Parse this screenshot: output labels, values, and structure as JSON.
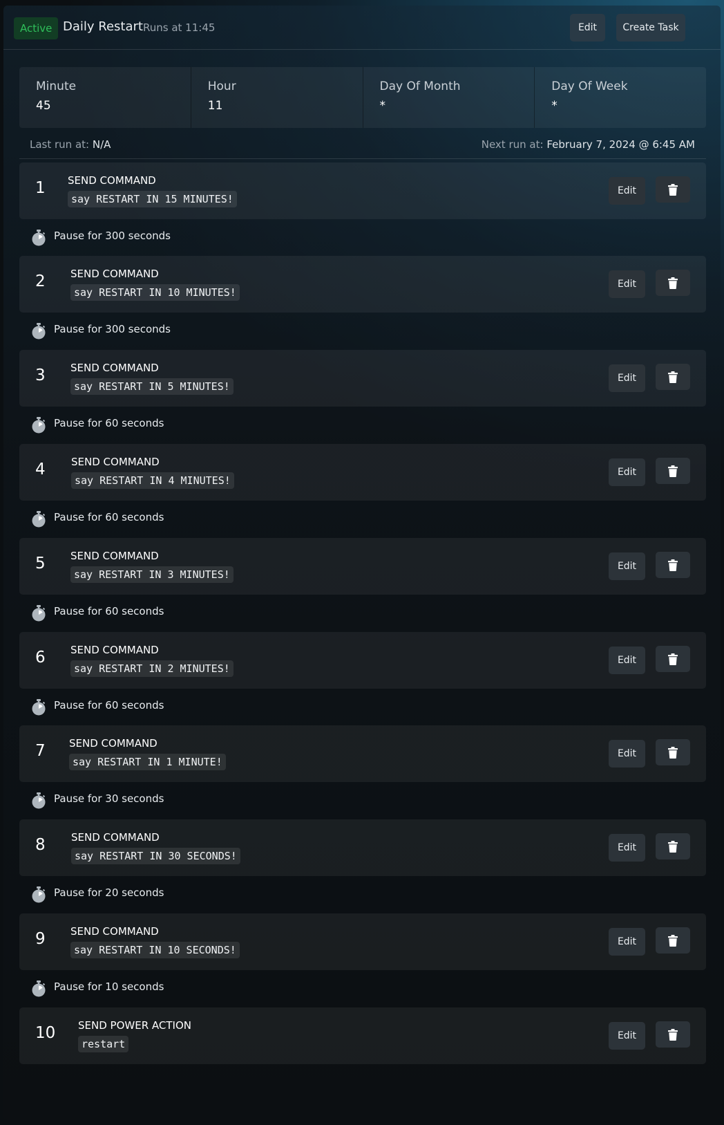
{
  "header": {
    "status_badge": "Active",
    "title": "Daily Restart",
    "subtitle": "Runs at 11:45",
    "edit_label": "Edit",
    "create_task_label": "Create Task"
  },
  "schedule": {
    "minute_label": "Minute",
    "minute": "45",
    "hour_label": "Hour",
    "hour": "11",
    "day_of_month_label": "Day Of Month",
    "day_of_month": "*",
    "day_of_week_label": "Day Of Week",
    "day_of_week": "*"
  },
  "runs": {
    "last_label": "Last run at:",
    "last_value": "N/A",
    "next_label": "Next run at:",
    "next_value": "February 7, 2024 @ 6:45 AM"
  },
  "step_edit_label": "Edit",
  "steps": [
    {
      "num": "1",
      "type": "SEND COMMAND",
      "command": "say RESTART IN 15 MINUTES!",
      "pause": "Pause for 300 seconds"
    },
    {
      "num": "2",
      "type": "SEND COMMAND",
      "command": "say RESTART IN 10 MINUTES!",
      "pause": "Pause for 300 seconds"
    },
    {
      "num": "3",
      "type": "SEND COMMAND",
      "command": "say RESTART IN 5 MINUTES!",
      "pause": "Pause for 60 seconds"
    },
    {
      "num": "4",
      "type": "SEND COMMAND",
      "command": "say RESTART IN 4 MINUTES!",
      "pause": "Pause for 60 seconds"
    },
    {
      "num": "5",
      "type": "SEND COMMAND",
      "command": "say RESTART IN 3 MINUTES!",
      "pause": "Pause for 60 seconds"
    },
    {
      "num": "6",
      "type": "SEND COMMAND",
      "command": "say RESTART IN 2 MINUTES!",
      "pause": "Pause for 60 seconds"
    },
    {
      "num": "7",
      "type": "SEND COMMAND",
      "command": "say RESTART IN 1 MINUTE!",
      "pause": "Pause for 30 seconds"
    },
    {
      "num": "8",
      "type": "SEND COMMAND",
      "command": "say RESTART IN 30 SECONDS!",
      "pause": "Pause for 20 seconds"
    },
    {
      "num": "9",
      "type": "SEND COMMAND",
      "command": "say RESTART IN 10 SECONDS!",
      "pause": "Pause for 10 seconds"
    },
    {
      "num": "10",
      "type": "SEND POWER ACTION",
      "command": "restart",
      "pause": null
    }
  ],
  "icons": {
    "pause_icon": "stopwatch-icon",
    "delete_icon": "trash-icon"
  },
  "colors": {
    "active_badge_text": "#2fbf5a",
    "active_badge_bg": "#123d24"
  }
}
